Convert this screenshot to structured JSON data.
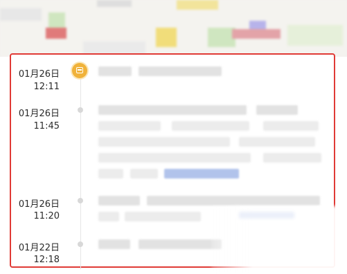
{
  "timeline": {
    "entries": [
      {
        "date": "01月26日",
        "time": "12:11"
      },
      {
        "date": "01月26日",
        "time": "11:45"
      },
      {
        "date": "01月26日",
        "time": "11:20"
      },
      {
        "date": "01月22日",
        "time": "12:18"
      }
    ]
  },
  "colors": {
    "highlight_border": "#e03a35",
    "badge": "#f0b23a",
    "timeline_dot": "#d8d8d8",
    "link": "#a9bde9"
  },
  "icons": {
    "first_entry": "document-icon"
  }
}
